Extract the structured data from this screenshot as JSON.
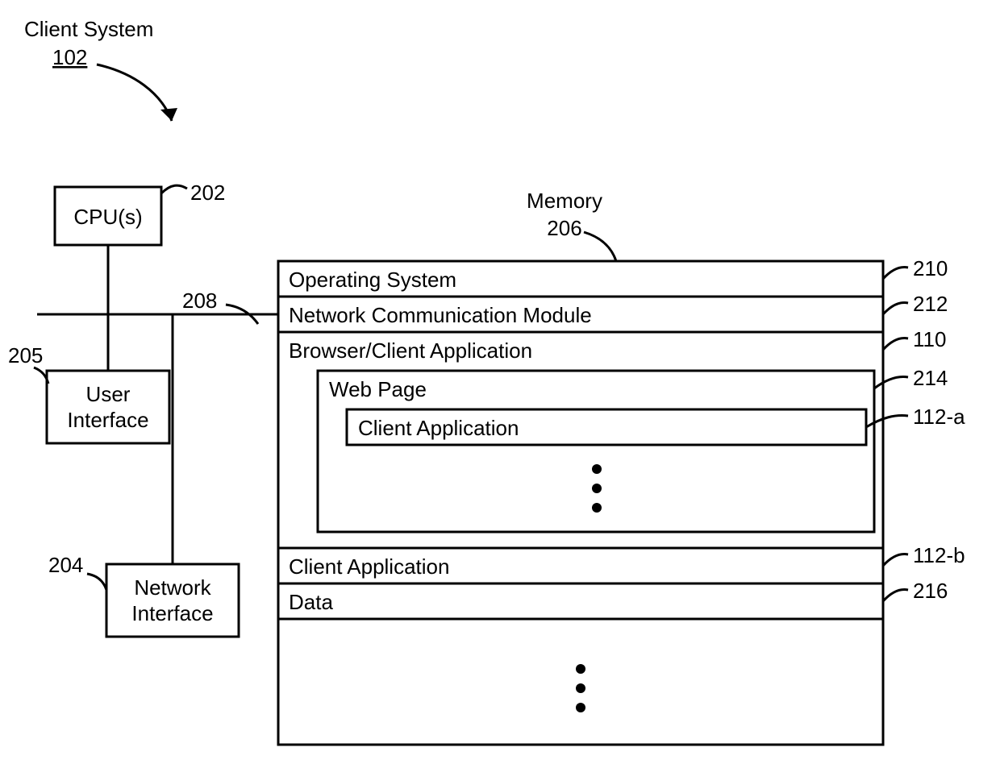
{
  "title": "Client System",
  "title_ref": "102",
  "cpu_label": "CPU(s)",
  "cpu_ref": "202",
  "ui_label_line1": "User",
  "ui_label_line2": "Interface",
  "ui_ref": "205",
  "ni_label_line1": "Network",
  "ni_label_line2": "Interface",
  "ni_ref": "204",
  "bus_ref": "208",
  "memory_label": "Memory",
  "memory_ref": "206",
  "rows": {
    "os": "Operating System",
    "ncm": "Network Communication Module",
    "bca": "Browser/Client Application",
    "webpage": "Web Page",
    "client_app_inner": "Client Application",
    "client_app_outer": "Client Application",
    "data": "Data"
  },
  "refs": {
    "os": "210",
    "ncm": "212",
    "bca": "110",
    "webpage": "214",
    "client_app_inner": "112-a",
    "client_app_outer": "112-b",
    "data": "216"
  }
}
